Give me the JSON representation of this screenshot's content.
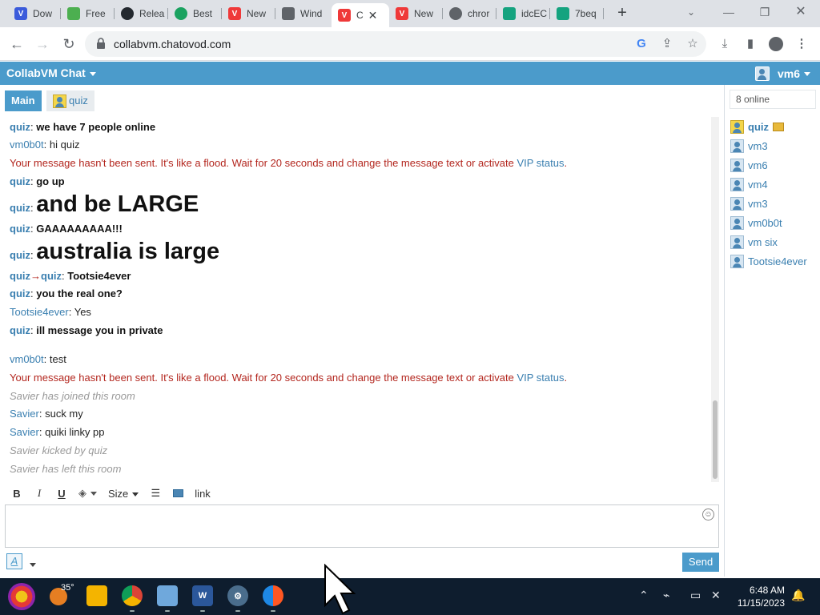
{
  "browser": {
    "tabs": [
      {
        "label": "Dow",
        "icon": "v-icon",
        "color": "#3b5bdb"
      },
      {
        "label": "Free",
        "icon": "globe-leaf-icon",
        "color": "#4caf50"
      },
      {
        "label": "Relea",
        "icon": "github-icon",
        "color": "#24292f"
      },
      {
        "label": "Best",
        "icon": "green-circle-icon",
        "color": "#1aa260"
      },
      {
        "label": "New",
        "icon": "vivaldi-icon",
        "color": "#ef3939"
      },
      {
        "label": "Wind",
        "icon": "window-icon",
        "color": "#5f6368"
      },
      {
        "label": "C",
        "icon": "vivaldi-icon",
        "color": "#ef3939"
      },
      {
        "label": "New",
        "icon": "vivaldi-icon",
        "color": "#ef3939"
      },
      {
        "label": "chror",
        "icon": "globe-icon",
        "color": "#5f6368"
      },
      {
        "label": "idcEC",
        "icon": "green-square-icon",
        "color": "#15a37f"
      },
      {
        "label": "7beq",
        "icon": "green-square-icon",
        "color": "#15a37f"
      }
    ],
    "active_tab_index": 6,
    "url": "collabvm.chatovod.com"
  },
  "chat": {
    "app_title": "CollabVM Chat",
    "current_user": "vm6",
    "room_tabs": {
      "main": "Main",
      "private": "quiz"
    },
    "messages": {
      "m1": {
        "nick": "quiz",
        "text": "we have 7 people online"
      },
      "m2": {
        "nick": "vm0b0t",
        "text": "hi quiz"
      },
      "m3": {
        "text": "Your message hasn't been sent. It's like a flood. Wait for 20 seconds and change the message text or activate",
        "link": "VIP status",
        "tail": "."
      },
      "m4": {
        "nick": "quiz",
        "text": "go up"
      },
      "m5": {
        "nick": "quiz",
        "text": "and be LARGE"
      },
      "m6": {
        "nick": "quiz",
        "text": "GAAAAAAAAA!!!"
      },
      "m7": {
        "nick": "quiz",
        "text": "australia is large"
      },
      "m8": {
        "nick": "quiz",
        "arrow": "→",
        "to": "quiz",
        "text": "Tootsie4ever"
      },
      "m9": {
        "nick": "quiz",
        "text": "you the real one?"
      },
      "m10": {
        "nick": "Tootsie4ever",
        "text": "Yes"
      },
      "m11": {
        "nick": "quiz",
        "text": "ill message you in private"
      },
      "m12": {
        "nick": "vm0b0t",
        "text": "test"
      },
      "m13": {
        "text": "Your message hasn't been sent. It's like a flood. Wait for 20 seconds and change the message text or activate",
        "link": "VIP status",
        "tail": "."
      },
      "m14": {
        "text": "Savier has joined this room"
      },
      "m15": {
        "nick": "Savier",
        "text": "suck my"
      },
      "m16": {
        "nick": "Savier",
        "text": "quiki linky pp"
      },
      "m17": {
        "text": "Savier kicked by quiz"
      },
      "m18": {
        "text": "Savier has left this room"
      }
    },
    "online_count": "8 online",
    "users": [
      "quiz",
      "vm3",
      "vm6",
      "vm4",
      "vm3",
      "vm0b0t",
      "vm six",
      "Tootsie4ever"
    ],
    "editor": {
      "bold": "B",
      "italic": "I",
      "underline": "U",
      "size": "Size",
      "link": "link",
      "format_button": "A",
      "send": "Send"
    }
  },
  "taskbar": {
    "weather": "35°",
    "time": "6:48 AM",
    "date": "11/15/2023"
  }
}
